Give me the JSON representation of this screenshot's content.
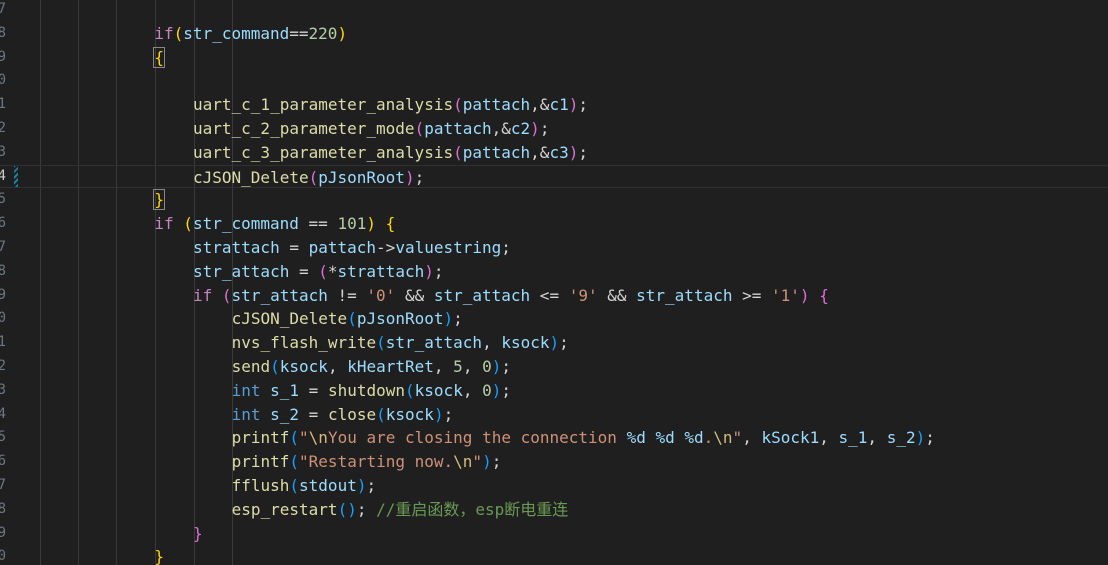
{
  "gutter": {
    "line_numbers": [
      "7",
      "8",
      "9",
      "0",
      "1",
      "2",
      "3",
      "4",
      "5",
      "6",
      "7",
      "8",
      "9",
      "0",
      "1",
      "2",
      "3",
      "4",
      "5",
      "6",
      "7",
      "8",
      "9",
      "0"
    ],
    "active_index": 7
  },
  "code": {
    "lines": [
      [],
      [
        [
          "kw",
          "if"
        ],
        [
          "p1",
          "("
        ],
        [
          "var",
          "str_command"
        ],
        [
          "op",
          "=="
        ],
        [
          "num",
          "220"
        ],
        [
          "p1",
          ")"
        ]
      ],
      [
        [
          "p1b",
          "{"
        ]
      ],
      [],
      [
        [
          "fn",
          "uart_c_1_parameter_analysis"
        ],
        [
          "p2",
          "("
        ],
        [
          "var",
          "pattach"
        ],
        [
          "op",
          ",&"
        ],
        [
          "var",
          "c1"
        ],
        [
          "p2",
          ")"
        ],
        [
          "op",
          ";"
        ]
      ],
      [
        [
          "fn",
          "uart_c_2_parameter_mode"
        ],
        [
          "p2",
          "("
        ],
        [
          "var",
          "pattach"
        ],
        [
          "op",
          ",&"
        ],
        [
          "var",
          "c2"
        ],
        [
          "p2",
          ")"
        ],
        [
          "op",
          ";"
        ]
      ],
      [
        [
          "fn",
          "uart_c_3_parameter_analysis"
        ],
        [
          "p2",
          "("
        ],
        [
          "var",
          "pattach"
        ],
        [
          "op",
          ",&"
        ],
        [
          "var",
          "c3"
        ],
        [
          "p2",
          ")"
        ],
        [
          "op",
          ";"
        ]
      ],
      [
        [
          "fn",
          "cJSON_Delete"
        ],
        [
          "p2",
          "("
        ],
        [
          "var",
          "pJsonRoot"
        ],
        [
          "p2",
          ")"
        ],
        [
          "op",
          ";"
        ]
      ],
      [
        [
          "p1b",
          "}"
        ]
      ],
      [
        [
          "kw",
          "if"
        ],
        [
          "op",
          " "
        ],
        [
          "p1",
          "("
        ],
        [
          "var",
          "str_command"
        ],
        [
          "op",
          " == "
        ],
        [
          "num",
          "101"
        ],
        [
          "p1",
          ")"
        ],
        [
          "op",
          " "
        ],
        [
          "p1",
          "{"
        ]
      ],
      [
        [
          "var",
          "strattach"
        ],
        [
          "op",
          " = "
        ],
        [
          "var",
          "pattach"
        ],
        [
          "op",
          "->"
        ],
        [
          "var",
          "valuestring"
        ],
        [
          "op",
          ";"
        ]
      ],
      [
        [
          "var",
          "str_attach"
        ],
        [
          "op",
          " = "
        ],
        [
          "p2",
          "("
        ],
        [
          "op",
          "*"
        ],
        [
          "var",
          "strattach"
        ],
        [
          "p2",
          ")"
        ],
        [
          "op",
          ";"
        ]
      ],
      [
        [
          "kw",
          "if"
        ],
        [
          "op",
          " "
        ],
        [
          "p2",
          "("
        ],
        [
          "var",
          "str_attach"
        ],
        [
          "op",
          " != "
        ],
        [
          "str",
          "'0'"
        ],
        [
          "op",
          " && "
        ],
        [
          "var",
          "str_attach"
        ],
        [
          "op",
          " <= "
        ],
        [
          "str",
          "'9'"
        ],
        [
          "op",
          " && "
        ],
        [
          "var",
          "str_attach"
        ],
        [
          "op",
          " >= "
        ],
        [
          "str",
          "'1'"
        ],
        [
          "p2",
          ")"
        ],
        [
          "op",
          " "
        ],
        [
          "p2",
          "{"
        ]
      ],
      [
        [
          "fn",
          "cJSON_Delete"
        ],
        [
          "p3",
          "("
        ],
        [
          "var",
          "pJsonRoot"
        ],
        [
          "p3",
          ")"
        ],
        [
          "op",
          ";"
        ]
      ],
      [
        [
          "fn",
          "nvs_flash_write"
        ],
        [
          "p3",
          "("
        ],
        [
          "var",
          "str_attach"
        ],
        [
          "op",
          ", "
        ],
        [
          "var",
          "ksock"
        ],
        [
          "p3",
          ")"
        ],
        [
          "op",
          ";"
        ]
      ],
      [
        [
          "fn",
          "send"
        ],
        [
          "p3",
          "("
        ],
        [
          "var",
          "ksock"
        ],
        [
          "op",
          ", "
        ],
        [
          "var",
          "kHeartRet"
        ],
        [
          "op",
          ", "
        ],
        [
          "num",
          "5"
        ],
        [
          "op",
          ", "
        ],
        [
          "num",
          "0"
        ],
        [
          "p3",
          ")"
        ],
        [
          "op",
          ";"
        ]
      ],
      [
        [
          "kw2",
          "int"
        ],
        [
          "op",
          " "
        ],
        [
          "var",
          "s_1"
        ],
        [
          "op",
          " = "
        ],
        [
          "fn",
          "shutdown"
        ],
        [
          "p3",
          "("
        ],
        [
          "var",
          "ksock"
        ],
        [
          "op",
          ", "
        ],
        [
          "num",
          "0"
        ],
        [
          "p3",
          ")"
        ],
        [
          "op",
          ";"
        ]
      ],
      [
        [
          "kw2",
          "int"
        ],
        [
          "op",
          " "
        ],
        [
          "var",
          "s_2"
        ],
        [
          "op",
          " = "
        ],
        [
          "fn",
          "close"
        ],
        [
          "p3",
          "("
        ],
        [
          "var",
          "ksock"
        ],
        [
          "p3",
          ")"
        ],
        [
          "op",
          ";"
        ]
      ],
      [
        [
          "fn",
          "printf"
        ],
        [
          "p3",
          "("
        ],
        [
          "str",
          "\""
        ],
        [
          "esc",
          "\\n"
        ],
        [
          "str",
          "You are closing the connection "
        ],
        [
          "fmt",
          "%d"
        ],
        [
          "str",
          " "
        ],
        [
          "fmt",
          "%d"
        ],
        [
          "str",
          " "
        ],
        [
          "fmt",
          "%d"
        ],
        [
          "str",
          "."
        ],
        [
          "esc",
          "\\n"
        ],
        [
          "str",
          "\""
        ],
        [
          "op",
          ", "
        ],
        [
          "var",
          "kSock1"
        ],
        [
          "op",
          ", "
        ],
        [
          "var",
          "s_1"
        ],
        [
          "op",
          ", "
        ],
        [
          "var",
          "s_2"
        ],
        [
          "p3",
          ")"
        ],
        [
          "op",
          ";"
        ]
      ],
      [
        [
          "fn",
          "printf"
        ],
        [
          "p3",
          "("
        ],
        [
          "str",
          "\"Restarting now."
        ],
        [
          "esc",
          "\\n"
        ],
        [
          "str",
          "\""
        ],
        [
          "p3",
          ")"
        ],
        [
          "op",
          ";"
        ]
      ],
      [
        [
          "fn",
          "fflush"
        ],
        [
          "p3",
          "("
        ],
        [
          "var",
          "stdout"
        ],
        [
          "p3",
          ")"
        ],
        [
          "op",
          ";"
        ]
      ],
      [
        [
          "fn",
          "esp_restart"
        ],
        [
          "p3",
          "()"
        ],
        [
          "op",
          "; "
        ],
        [
          "cmt",
          "//重启函数，esp断电重连"
        ]
      ],
      [
        [
          "p2",
          "}"
        ]
      ],
      [
        [
          "p1",
          "}"
        ]
      ]
    ],
    "indents": [
      0,
      4,
      4,
      0,
      5,
      5,
      5,
      5,
      4,
      4,
      5,
      5,
      5,
      6,
      6,
      6,
      6,
      6,
      6,
      6,
      6,
      6,
      5,
      4
    ]
  }
}
